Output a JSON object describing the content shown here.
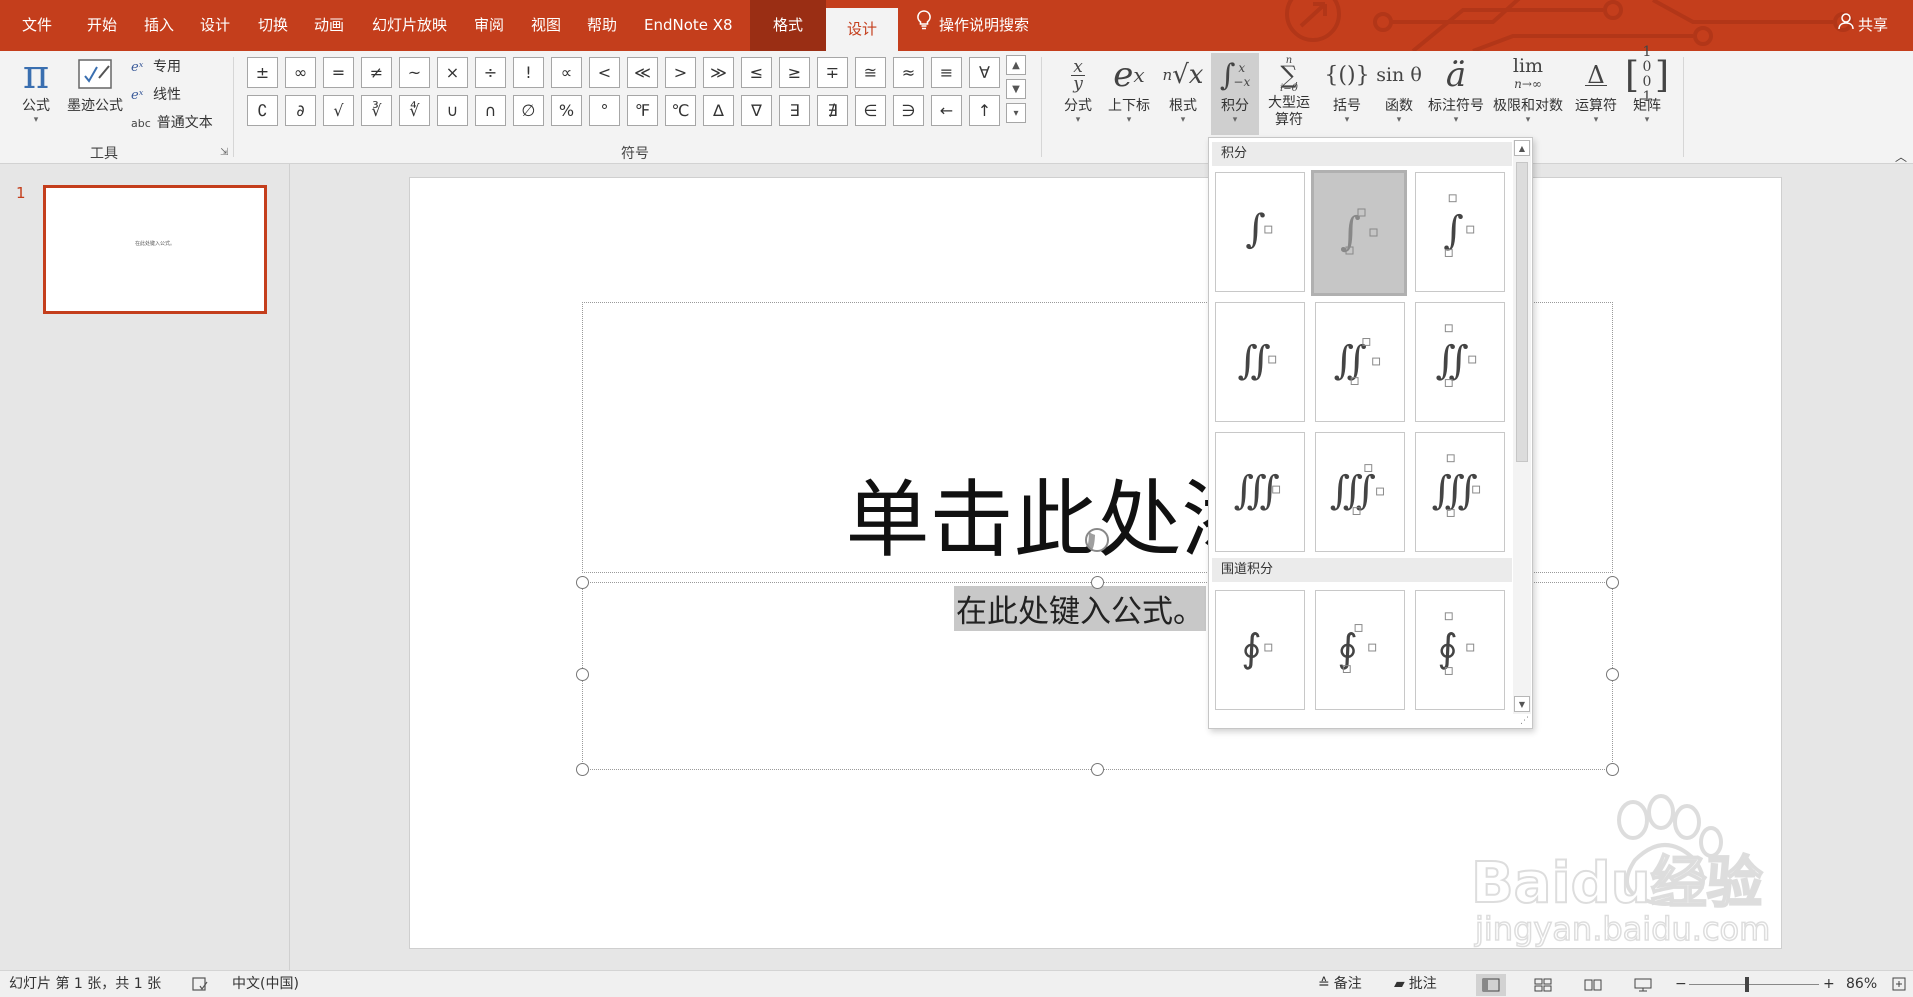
{
  "tabs": {
    "items": [
      "文件",
      "开始",
      "插入",
      "设计",
      "切换",
      "动画",
      "幻灯片放映",
      "审阅",
      "视图",
      "帮助",
      "EndNote X8"
    ],
    "context": "格式",
    "active": "设计",
    "search": "操作说明搜索",
    "share": "共享"
  },
  "tools_group": {
    "label": "工具",
    "equation": "公式",
    "ink_equation": "墨迹公式",
    "professional": "专用",
    "linear": "线性",
    "normal_text": "普通文本",
    "normal_text_prefix": "abc"
  },
  "symbols_group": {
    "label": "符号",
    "row1": [
      "±",
      "∞",
      "=",
      "≠",
      "~",
      "×",
      "÷",
      "!",
      "∝",
      "<",
      "≪",
      ">",
      "≫",
      "≤",
      "≥",
      "∓",
      "≅",
      "≈",
      "≡",
      "∀"
    ],
    "row2": [
      "∁",
      "∂",
      "√",
      "∛",
      "∜",
      "∪",
      "∩",
      "∅",
      "%",
      "°",
      "℉",
      "℃",
      "∆",
      "∇",
      "∃",
      "∄",
      "∈",
      "∋",
      "←",
      "↑"
    ]
  },
  "structures": {
    "fraction": "分式",
    "script": "上下标",
    "radical": "根式",
    "integral": "积分",
    "large_operator": "大型运算符",
    "bracket": "括号",
    "function": "函数",
    "accent": "标注符号",
    "limit_log": "极限和对数",
    "operator": "运算符",
    "matrix": "矩阵"
  },
  "thumbnail": {
    "number": "1",
    "text": "在此处键入公式。"
  },
  "slide": {
    "title": "单击此处添加",
    "formula": "在此处键入公式。"
  },
  "dropdown": {
    "section1": "积分",
    "section2": "围道积分"
  },
  "statusbar": {
    "slide_info": "幻灯片 第 1 张，共 1 张",
    "language": "中文(中国)",
    "notes": "备注",
    "comments": "批注",
    "zoom": "86%",
    "zoom_level": 0.86
  },
  "watermark": {
    "brand": "Baidu经验",
    "url": "jingyan.baidu.com"
  },
  "colors": {
    "accent": "#c43e1c",
    "ribbon": "#f3f3f3",
    "context_tab": "#9a2e14"
  }
}
